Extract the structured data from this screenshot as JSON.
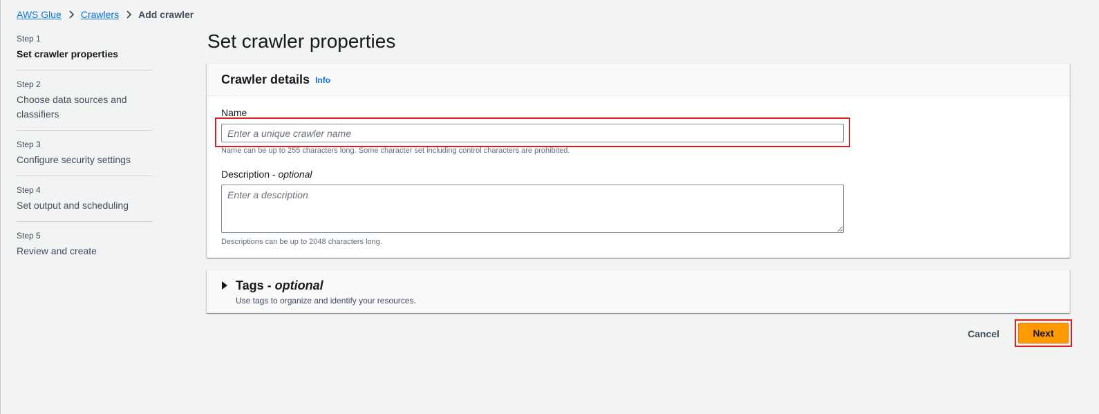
{
  "breadcrumb": {
    "items": [
      {
        "label": "AWS Glue"
      },
      {
        "label": "Crawlers"
      },
      {
        "label": "Add crawler"
      }
    ]
  },
  "steps": [
    {
      "number": "Step 1",
      "title": "Set crawler properties"
    },
    {
      "number": "Step 2",
      "title": "Choose data sources and classifiers"
    },
    {
      "number": "Step 3",
      "title": "Configure security settings"
    },
    {
      "number": "Step 4",
      "title": "Set output and scheduling"
    },
    {
      "number": "Step 5",
      "title": "Review and create"
    }
  ],
  "page": {
    "title": "Set crawler properties"
  },
  "crawler_details": {
    "title": "Crawler details",
    "info": "Info",
    "name_label": "Name",
    "name_placeholder": "Enter a unique crawler name",
    "name_value": "",
    "name_hint": "Name can be up to 255 characters long. Some character set including control characters are prohibited.",
    "description_label": "Description - ",
    "description_optional": "optional",
    "description_placeholder": "Enter a description",
    "description_value": "",
    "description_hint": "Descriptions can be up to 2048 characters long."
  },
  "tags": {
    "title": "Tags - ",
    "optional": "optional",
    "subtitle": "Use tags to organize and identify your resources."
  },
  "actions": {
    "cancel": "Cancel",
    "next": "Next"
  },
  "colors": {
    "link": "#0972d3",
    "primary_button": "#ff9900",
    "highlight": "#e01a1a"
  }
}
